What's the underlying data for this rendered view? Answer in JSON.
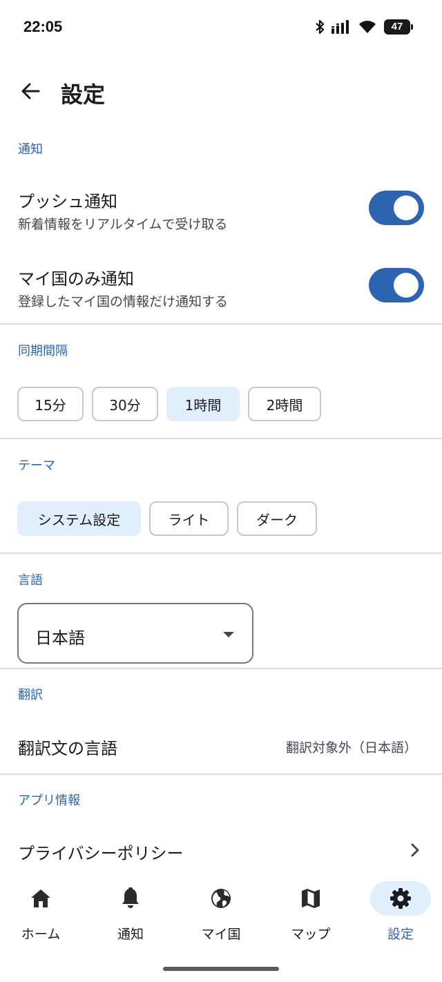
{
  "status_bar": {
    "time": "22:05",
    "battery": "47",
    "icons": [
      "bluetooth-icon",
      "signal-icon",
      "wifi-icon",
      "battery-icon"
    ]
  },
  "app_bar": {
    "title": "設定",
    "back_icon": "arrow-back-icon"
  },
  "notifications": {
    "section_label": "通知",
    "push": {
      "title": "プッシュ通知",
      "subtitle": "新着情報をリアルタイムで受け取る",
      "enabled": true
    },
    "my_country_only": {
      "title": "マイ国のみ通知",
      "subtitle": "登録したマイ国の情報だけ通知する",
      "enabled": true
    }
  },
  "sync": {
    "section_label": "同期間隔",
    "options": [
      "15分",
      "30分",
      "1時間",
      "2時間"
    ],
    "selected": "1時間"
  },
  "theme": {
    "section_label": "テーマ",
    "options": [
      "システム設定",
      "ライト",
      "ダーク"
    ],
    "selected": "システム設定"
  },
  "language": {
    "section_label": "言語",
    "selected": "日本語"
  },
  "translation": {
    "section_label": "翻訳",
    "row_title": "翻訳文の言語",
    "row_value": "翻訳対象外（日本語）"
  },
  "app_info": {
    "section_label": "アプリ情報",
    "privacy_policy": "プライバシーポリシー"
  },
  "bottom_nav": {
    "items": [
      {
        "label": "ホーム",
        "icon": "home-icon"
      },
      {
        "label": "通知",
        "icon": "bell-icon"
      },
      {
        "label": "マイ国",
        "icon": "globe-icon"
      },
      {
        "label": "マップ",
        "icon": "map-icon"
      },
      {
        "label": "設定",
        "icon": "gear-icon"
      }
    ],
    "active": "設定"
  },
  "colors": {
    "accent": "#2e63b1",
    "section_label": "#2d62a8",
    "selected_chip_bg": "#e1eefb"
  }
}
